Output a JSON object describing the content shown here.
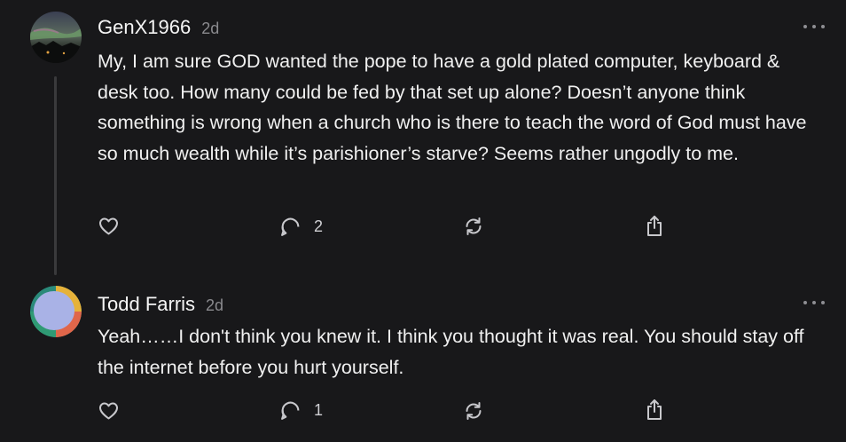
{
  "comments": [
    {
      "username": "GenX1966",
      "time": "2d",
      "text": "My, I am sure GOD wanted the pope to have a gold plated computer, keyboard & desk too. How many could be fed by that set up alone? Doesn’t anyone think something is wrong when a church who is there to teach the word of God must have so much wealth while it’s parishioner’s starve? Seems rather ungodly to me.",
      "reply_count": "2",
      "avatar": "aurora-landscape-avatar"
    },
    {
      "username": "Todd Farris",
      "time": "2d",
      "text": "Yeah……I don't think you knew it. I think you thought it was real. You should stay off the internet before you hurt yourself.",
      "reply_count": "1",
      "avatar": "colorful-ring-avatar"
    }
  ],
  "icons": {
    "like": "heart-icon",
    "reply": "comment-bubble-icon",
    "repost": "repost-arrows-icon",
    "share": "share-upload-icon",
    "more": "more-dots-icon"
  },
  "colors": {
    "background": "#18181a",
    "text": "#f0f0f0",
    "muted": "#8a8a8e",
    "icon": "#c8c8cc"
  }
}
